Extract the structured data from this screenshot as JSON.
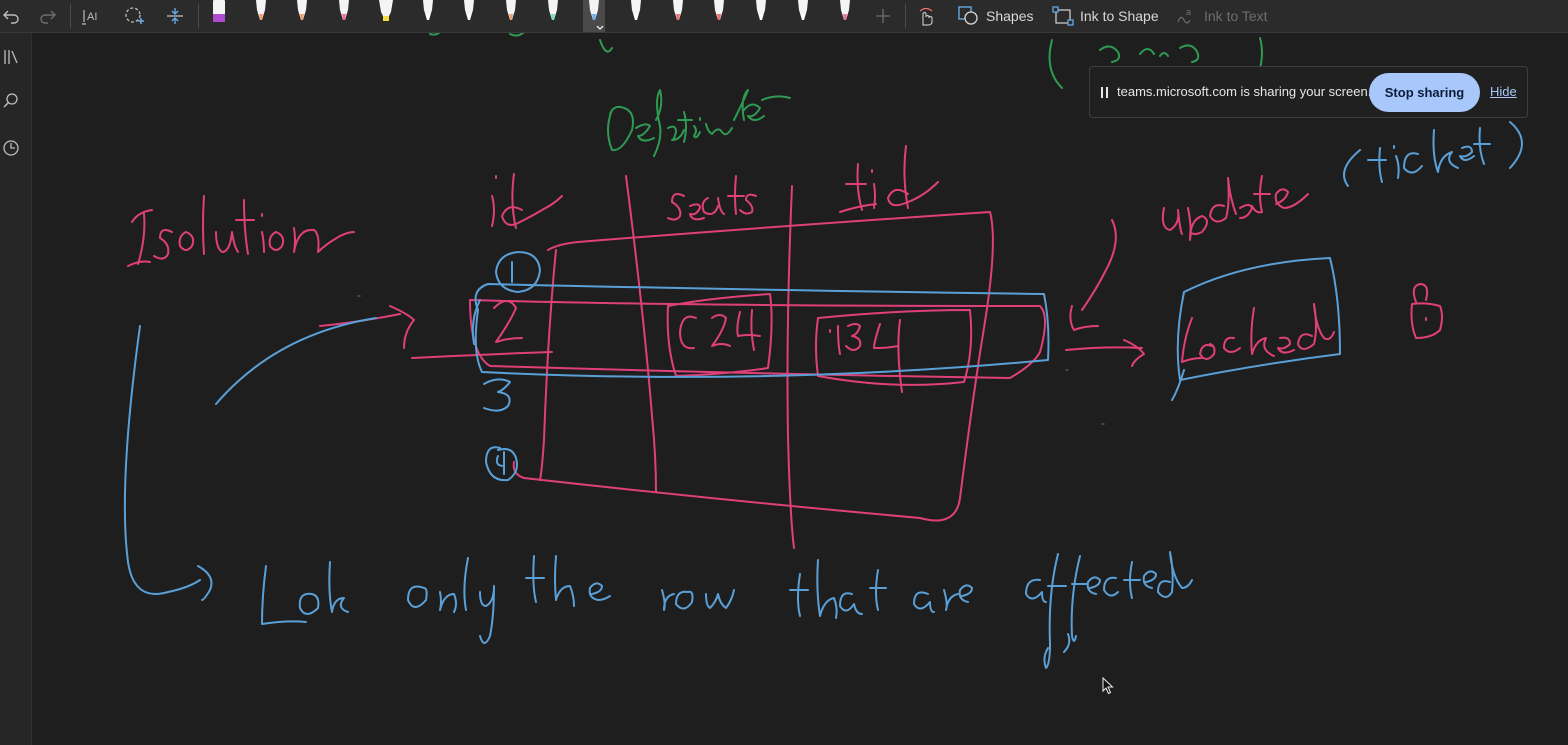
{
  "toolbar": {
    "undo_icon": "undo-icon",
    "redo_icon": "redo-icon",
    "tools": [
      "text-select-icon",
      "lasso-select-icon",
      "insert-space-icon"
    ],
    "pens": [
      {
        "color": "#b04ad0",
        "kind": "marker"
      },
      {
        "color": "#f0a070",
        "kind": "pen"
      },
      {
        "color": "#f0a070",
        "kind": "pen"
      },
      {
        "color": "#f07090",
        "kind": "pen"
      },
      {
        "color": "#f0e040",
        "kind": "highlighter"
      },
      {
        "color": "#ffffff",
        "kind": "pen"
      },
      {
        "color": "#ffffff",
        "kind": "pen"
      },
      {
        "color": "#f0a070",
        "kind": "pen"
      },
      {
        "color": "#70e0c0",
        "kind": "pen"
      },
      {
        "color": "#6ab0f0",
        "kind": "pen",
        "active": true
      },
      {
        "color": "#ffffff",
        "kind": "pen"
      },
      {
        "color": "#f07070",
        "kind": "pen"
      },
      {
        "color": "#f07070",
        "kind": "pen"
      },
      {
        "color": "#ffffff",
        "kind": "pen"
      },
      {
        "color": "#ffffff",
        "kind": "pen"
      },
      {
        "color": "#f07090",
        "kind": "pen"
      }
    ],
    "add_pen_icon": "plus-icon",
    "touch_draw_icon": "touch-draw-icon",
    "shapes_label": "Shapes",
    "ink_to_shape_label": "Ink to Shape",
    "ink_to_text_label": "Ink to Text"
  },
  "sidebar": {
    "items": [
      "library-icon",
      "search-icon",
      "history-icon"
    ]
  },
  "share_notice": {
    "message": "teams.microsoft.com is sharing your screen.",
    "stop_label": "Stop sharing",
    "hide_label": "Hide"
  },
  "colors": {
    "pink_ink": "#e0407a",
    "blue_ink": "#5aa0d8",
    "green_ink": "#2e9a52",
    "background": "#1e1e1e",
    "accent": "#a8c7fa"
  }
}
